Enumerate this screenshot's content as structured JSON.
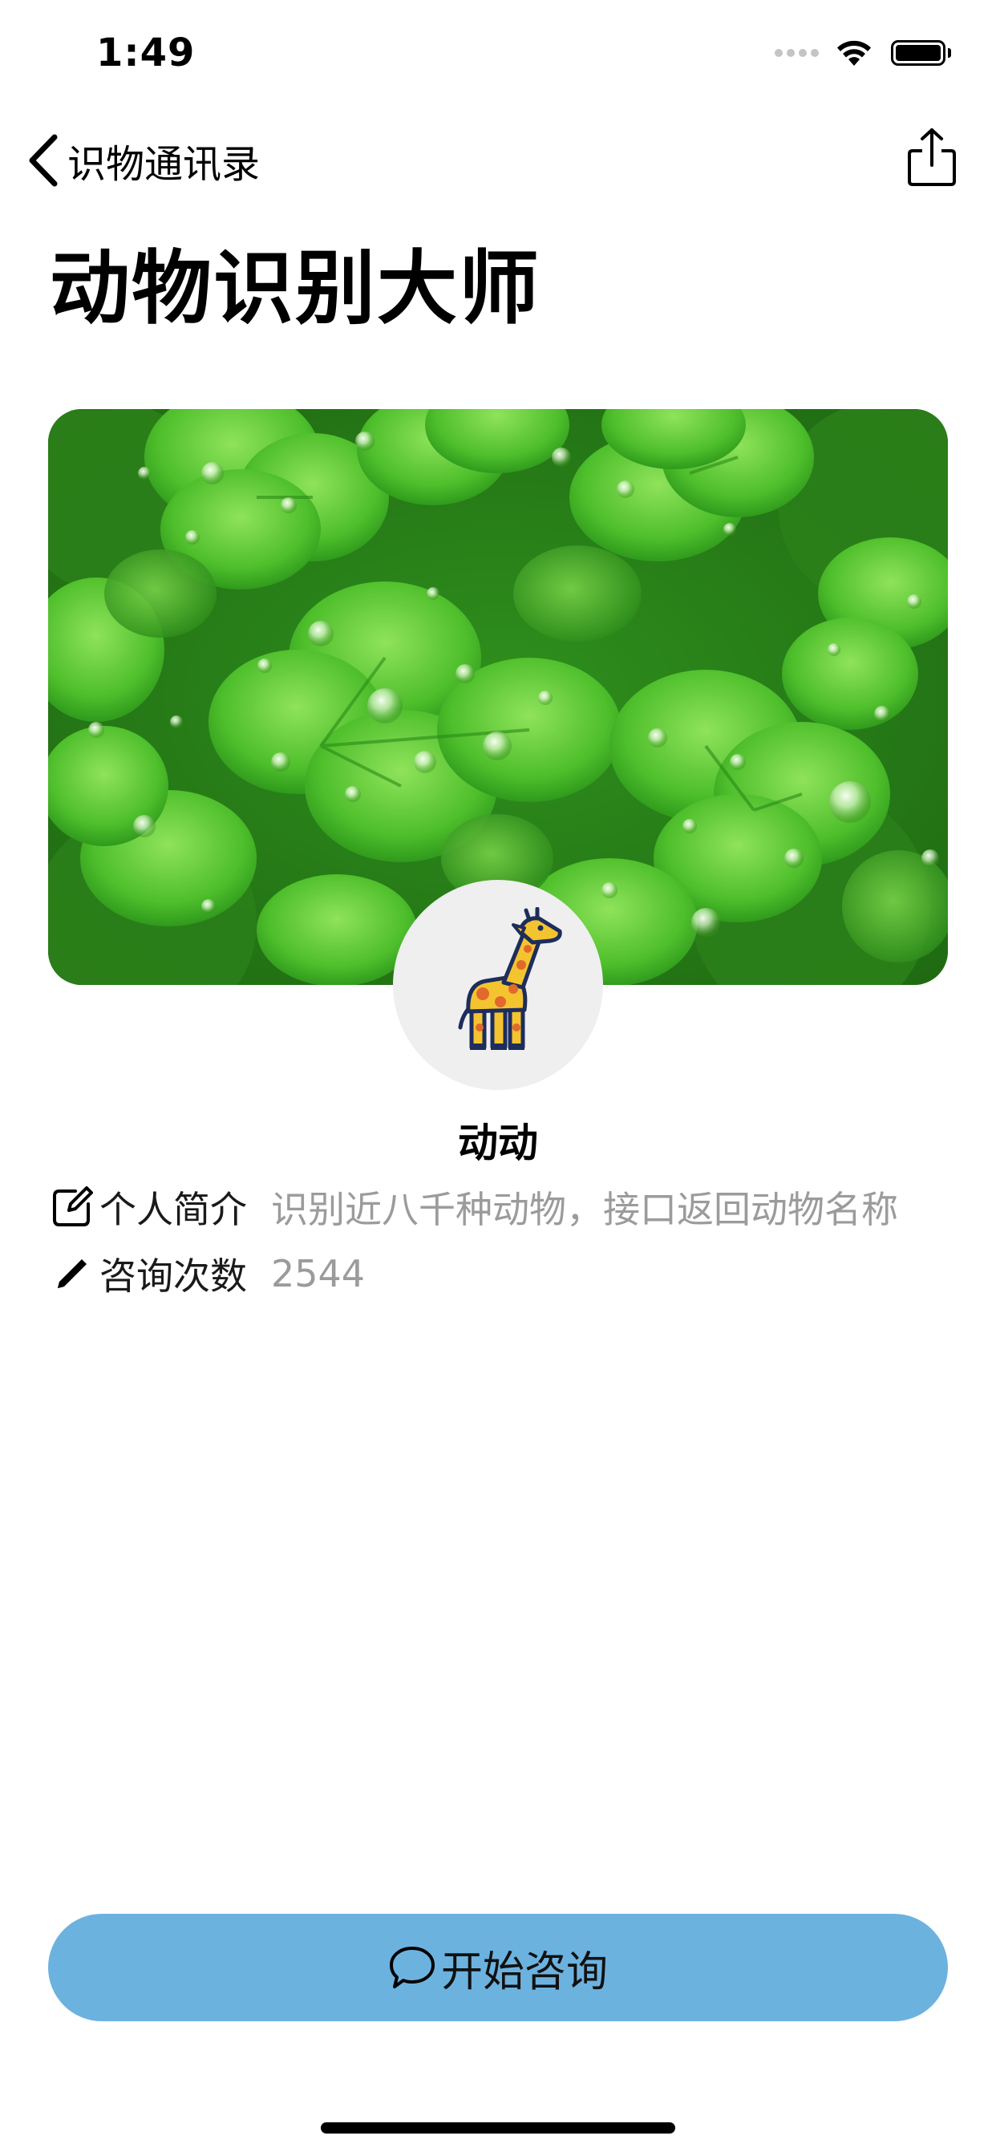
{
  "status_bar": {
    "time": "1:49"
  },
  "nav": {
    "back_label": "识物通讯录",
    "back_icon": "chevron-left-icon",
    "share_icon": "share-icon"
  },
  "page": {
    "title": "动物识别大师"
  },
  "banner": {
    "image": "clover-leaves-with-water-drops"
  },
  "bot": {
    "avatar_icon": "giraffe-icon",
    "name": "动动"
  },
  "info": {
    "bio": {
      "icon": "edit-square-icon",
      "label": "个人简介",
      "value": "识别近八千种动物，接口返回动物名称"
    },
    "count": {
      "icon": "pencil-icon",
      "label": "咨询次数",
      "value": "2544"
    }
  },
  "actions": {
    "consult_icon": "chat-bubble-icon",
    "consult_label": "开始咨询"
  },
  "colors": {
    "button_bg": "#6cb2df",
    "secondary_text": "#9b9b9b",
    "avatar_bg": "#efefef"
  }
}
